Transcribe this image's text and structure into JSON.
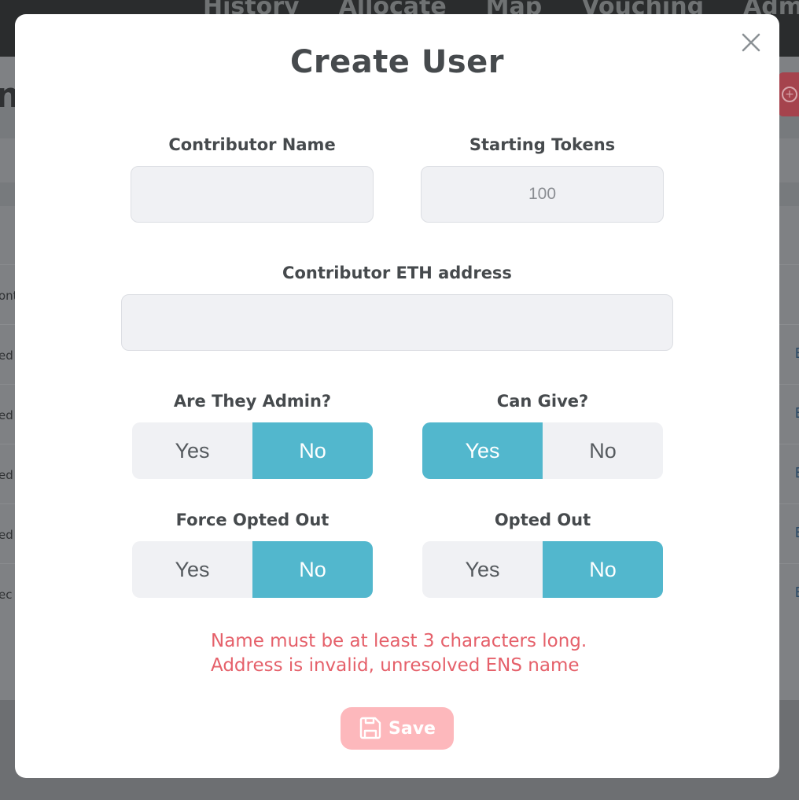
{
  "background": {
    "nav": [
      "History",
      "Allocate",
      "Map",
      "Vouching",
      "Admin"
    ],
    "page_title_fragment": "n",
    "rows": [
      {
        "cell": "ont",
        "edit": ""
      },
      {
        "cell": "ed",
        "edit": "E"
      },
      {
        "cell": "ed J",
        "edit": "E"
      },
      {
        "cell": "ed",
        "edit": "E"
      },
      {
        "cell": "ed",
        "edit": "E"
      },
      {
        "cell": "ec",
        "edit": "E"
      }
    ]
  },
  "modal": {
    "title": "Create User",
    "close_icon": "close-icon",
    "fields": {
      "contributor_name": {
        "label": "Contributor Name",
        "value": "",
        "placeholder": ""
      },
      "starting_tokens": {
        "label": "Starting Tokens",
        "value": "",
        "placeholder": "100"
      },
      "eth_address": {
        "label": "Contributor ETH address",
        "value": "",
        "placeholder": ""
      }
    },
    "toggles": {
      "is_admin": {
        "label": "Are They Admin?",
        "yes": "Yes",
        "no": "No",
        "selected": "No"
      },
      "can_give": {
        "label": "Can Give?",
        "yes": "Yes",
        "no": "No",
        "selected": "Yes"
      },
      "force_opted_out": {
        "label": "Force Opted Out",
        "yes": "Yes",
        "no": "No",
        "selected": "No"
      },
      "opted_out": {
        "label": "Opted Out",
        "yes": "Yes",
        "no": "No",
        "selected": "No"
      }
    },
    "errors": [
      "Name must be at least 3 characters long.",
      "Address is invalid, unresolved ENS name"
    ],
    "save": {
      "label": "Save",
      "icon": "save-icon"
    }
  },
  "colors": {
    "accent": "#52b7cd",
    "error": "#e5606a",
    "save_disabled": "#fdb8bc",
    "input_bg": "#f0f1f4"
  }
}
